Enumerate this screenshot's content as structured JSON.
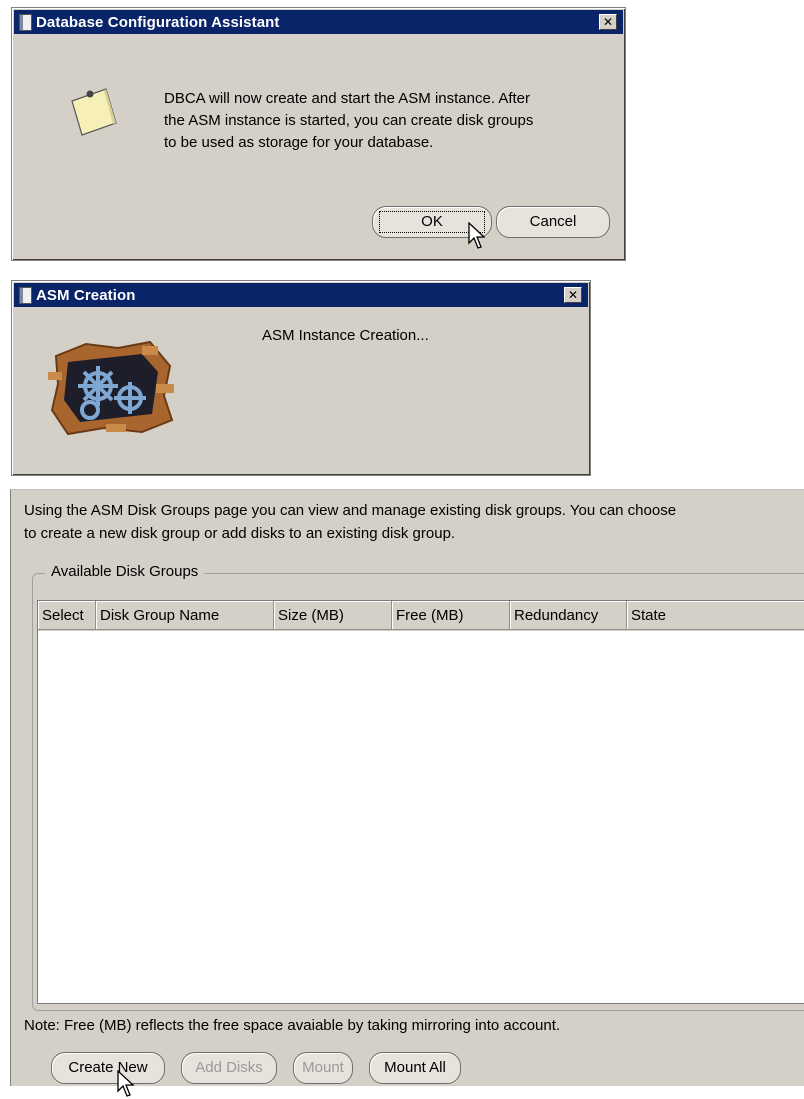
{
  "dialog1": {
    "title": "Database Configuration Assistant",
    "close_glyph": "✕",
    "icon": "note-icon",
    "message": [
      "DBCA will now create and start the ASM instance. After",
      "the ASM instance is started, you can create disk groups",
      "to be used as storage for your database."
    ],
    "ok_label": "OK",
    "cancel_label": "Cancel"
  },
  "dialog2": {
    "title": "ASM Creation",
    "close_glyph": "✕",
    "icon": "gears-in-wall-icon",
    "status": "ASM Instance Creation..."
  },
  "panel": {
    "intro": [
      "Using the ASM Disk Groups page you can view and manage existing disk groups. You can choose",
      "to create a new disk group or add disks to an existing disk group."
    ],
    "group_title": "Available Disk Groups",
    "columns": [
      "Select",
      "Disk Group Name",
      "Size (MB)",
      "Free (MB)",
      "Redundancy",
      "State"
    ],
    "rows": [],
    "note": "Note: Free (MB) reflects the free space avaiable by taking mirroring into account.",
    "buttons": {
      "create_new": "Create New",
      "add_disks": "Add Disks",
      "mount": "Mount",
      "mount_all": "Mount All"
    }
  },
  "colors": {
    "titlebar": "#0a246a",
    "dialog_bg": "#d4d0c8",
    "disabled_text": "#9a9a9a"
  }
}
